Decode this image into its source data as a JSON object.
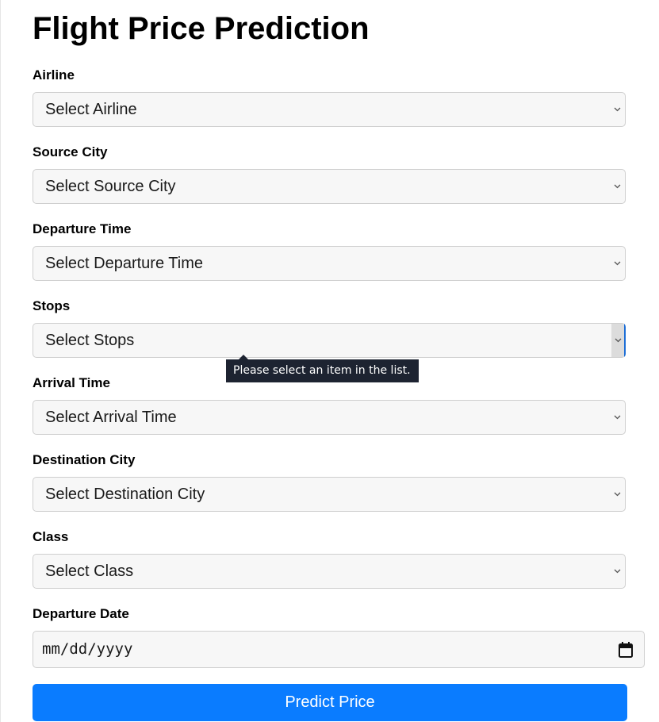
{
  "page": {
    "title": "Flight Price Prediction"
  },
  "form": {
    "fields": [
      {
        "label": "Airline",
        "selected": "Select Airline"
      },
      {
        "label": "Source City",
        "selected": "Select Source City"
      },
      {
        "label": "Departure Time",
        "selected": "Select Departure Time"
      },
      {
        "label": "Stops",
        "selected": "Select Stops"
      },
      {
        "label": "Arrival Time",
        "selected": "Select Arrival Time"
      },
      {
        "label": "Destination City",
        "selected": "Select Destination City"
      },
      {
        "label": "Class",
        "selected": "Select Class"
      }
    ],
    "date": {
      "label": "Departure Date",
      "placeholder": "mm/dd/yyyy",
      "icon": "calendar-icon"
    },
    "submit_label": "Predict Price"
  },
  "validation": {
    "tooltip": "Please select an item in the list.",
    "field": "Stops"
  },
  "colors": {
    "accent": "#0a7cff",
    "tooltip_bg": "#1d2331",
    "input_bg": "#f7f7f7"
  }
}
